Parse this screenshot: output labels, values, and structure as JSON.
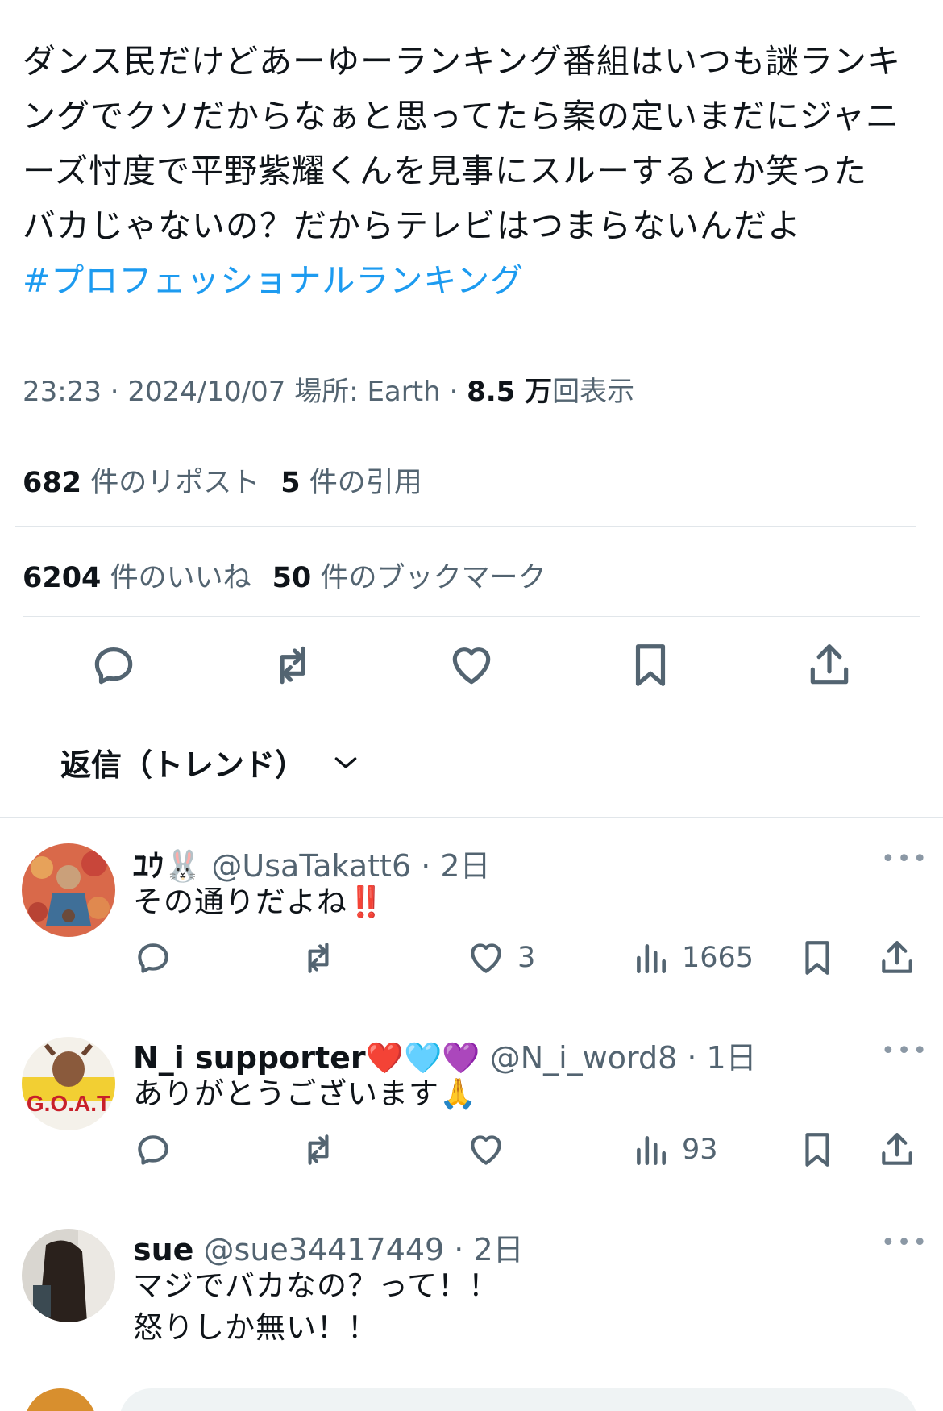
{
  "tweet": {
    "lines": [
      "ダンス民だけどあーゆーランキング番組はいつも謎ランキ",
      "ングでクソだからなぁと思ってたら案の定いまだにジャニ",
      "ーズ忖度で平野紫耀くんを見事にスルーするとか笑った",
      "バカじゃないの？だからテレビはつまらないんだよ"
    ],
    "hashtag": "#プロフェッショナルランキング",
    "time": "23:23 · 2024/10/07",
    "location": "場所: Earth",
    "dot": "·",
    "views_num": "8.5 万",
    "views_label": "回表示"
  },
  "stats": {
    "reposts_num": "682",
    "reposts_label": "件のリポスト",
    "quotes_num": "5",
    "quotes_label": "件の引用",
    "likes_num": "6204",
    "likes_label": "件のいいね",
    "bookmarks_num": "50",
    "bookmarks_label": "件のブックマーク"
  },
  "replies_sort": {
    "label": "返信（トレンド）"
  },
  "replies": [
    {
      "name": "ﾕｳ🐰",
      "handle": "@UsaTakatt6 · 2日",
      "lines": [
        "その通りだよね‼️"
      ],
      "likes": "3",
      "views": "1665"
    },
    {
      "name": "N_i supporter❤️🩵💜",
      "handle": "@N_i_word8 · 1日",
      "lines": [
        "ありがとうございます🙏"
      ],
      "likes": "",
      "views": "93"
    },
    {
      "name": "sue",
      "handle": "@sue34417449 · 2日",
      "lines": [
        "マジでバカなの？って！！",
        "怒りしか無い！！"
      ],
      "likes": "",
      "views": ""
    }
  ],
  "more_label": "•••",
  "colors": {
    "link": "#1d9bf0",
    "secondary": "#536471",
    "icon": "#536471",
    "divider": "#e1e6ea"
  }
}
